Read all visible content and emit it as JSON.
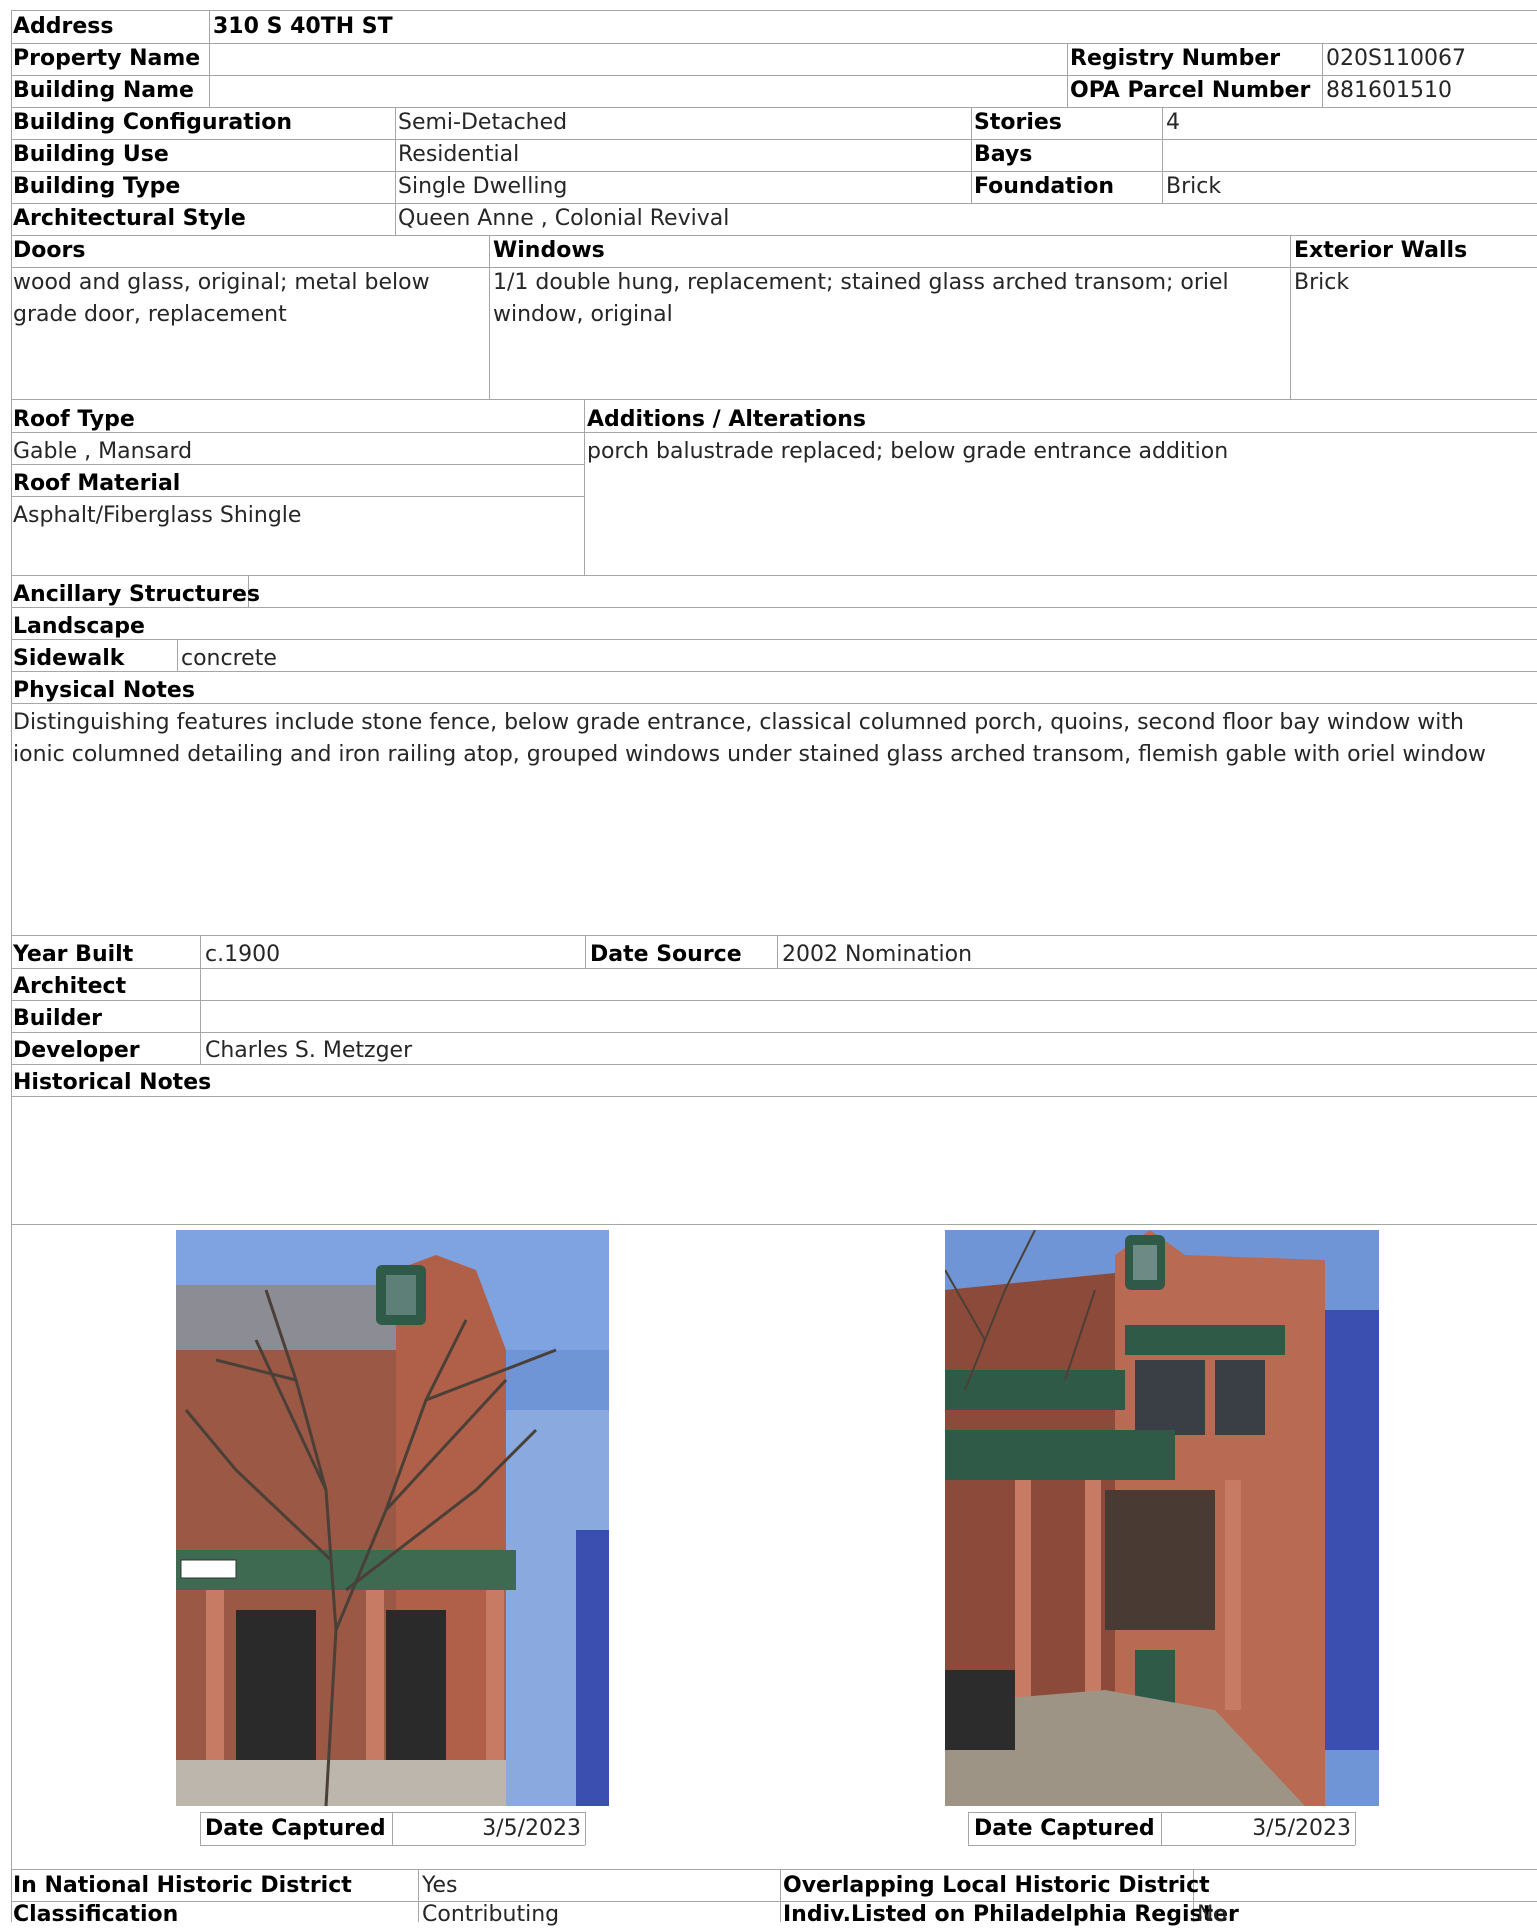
{
  "address": {
    "label": "Address",
    "value": "310 S 40TH ST"
  },
  "property_name": {
    "label": "Property Name",
    "value": ""
  },
  "registry_number": {
    "label": "Registry Number",
    "value": "020S110067"
  },
  "building_name": {
    "label": "Building Name",
    "value": ""
  },
  "opa_parcel_number": {
    "label": "OPA Parcel Number",
    "value": "881601510"
  },
  "building_configuration": {
    "label": "Building Configuration",
    "value": "Semi-Detached"
  },
  "stories": {
    "label": "Stories",
    "value": "4"
  },
  "building_use": {
    "label": "Building Use",
    "value": "Residential"
  },
  "bays": {
    "label": "Bays",
    "value": ""
  },
  "building_type": {
    "label": "Building Type",
    "value": "Single Dwelling"
  },
  "foundation": {
    "label": "Foundation",
    "value": "Brick"
  },
  "architectural_style": {
    "label": "Architectural Style",
    "value": "Queen Anne , Colonial Revival"
  },
  "doors": {
    "label": "Doors",
    "value": "wood and glass, original; metal below grade door, replacement"
  },
  "windows": {
    "label": "Windows",
    "value": "1/1 double hung, replacement; stained glass arched transom; oriel window, original"
  },
  "exterior_walls": {
    "label": "Exterior Walls",
    "value": "Brick"
  },
  "roof_type": {
    "label": "Roof Type",
    "value": "Gable , Mansard"
  },
  "additions": {
    "label": "Additions / Alterations",
    "value": "porch balustrade replaced; below grade entrance addition"
  },
  "roof_material": {
    "label": "Roof Material",
    "value": "Asphalt/Fiberglass Shingle"
  },
  "ancillary_structures": {
    "label": "Ancillary Structures",
    "value": ""
  },
  "landscape": {
    "label": "Landscape",
    "value": ""
  },
  "sidewalk": {
    "label": "Sidewalk",
    "value": "concrete"
  },
  "physical_notes": {
    "label": "Physical Notes",
    "value": "Distinguishing features include stone fence, below grade entrance, classical columned porch, quoins, second floor bay window with ionic columned detailing and iron railing atop, grouped windows under stained glass arched transom, flemish gable with oriel window"
  },
  "year_built": {
    "label": "Year Built",
    "value": "c.1900"
  },
  "date_source": {
    "label": "Date Source",
    "value": "2002 Nomination"
  },
  "architect": {
    "label": "Architect",
    "value": ""
  },
  "builder": {
    "label": "Builder",
    "value": ""
  },
  "developer": {
    "label": "Developer",
    "value": "Charles S. Metzger"
  },
  "historical_notes": {
    "label": "Historical Notes",
    "value": ""
  },
  "photos": [
    {
      "date_label": "Date Captured",
      "date_value": "3/5/2023"
    },
    {
      "date_label": "Date Captured",
      "date_value": "3/5/2023"
    }
  ],
  "national_district": {
    "label": "In National Historic District",
    "value": "Yes"
  },
  "local_district": {
    "label": "Overlapping Local Historic District",
    "value": ""
  },
  "classification": {
    "label": "Classification",
    "value": "Contributing"
  },
  "phila_register": {
    "label": "Indiv.Listed on Philadelphia Register",
    "value": "No"
  },
  "colors": {
    "border": "#a6a6a6",
    "sky": "#6f95d6",
    "brick": "#a8563e",
    "trim": "#2f5a48"
  }
}
